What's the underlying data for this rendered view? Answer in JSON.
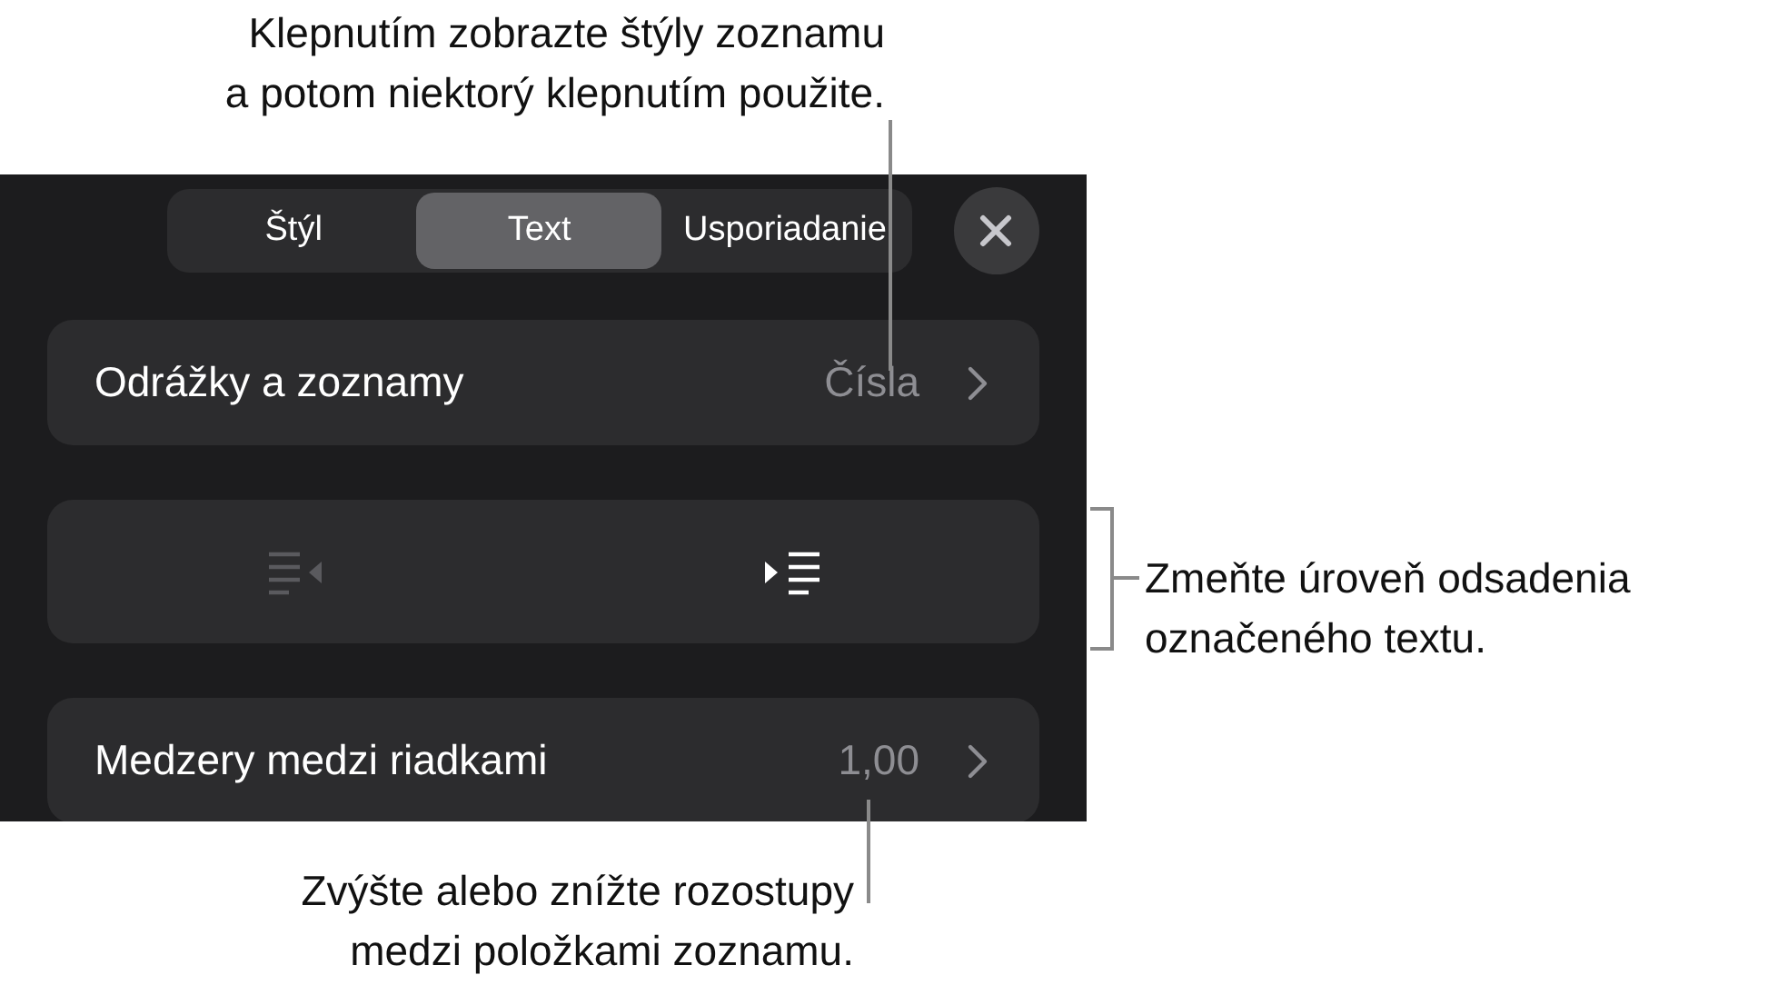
{
  "callouts": {
    "top": "Klepnutím zobrazte štýly zoznamu\na potom niektorý klepnutím použite.",
    "right": "Zmeňte úroveň odsadenia\noznačeného textu.",
    "bottom": "Zvýšte alebo znížte rozostupy\nmedzi položkami zoznamu."
  },
  "tabs": [
    {
      "label": "Štýl",
      "selected": false
    },
    {
      "label": "Text",
      "selected": true
    },
    {
      "label": "Usporiadanie",
      "selected": false
    }
  ],
  "rows": [
    {
      "kind": "disclosure",
      "label": "Odrážky a zoznamy",
      "value": "Čísla"
    },
    {
      "kind": "indent",
      "buttons": [
        {
          "kind": "outdent",
          "disabled": true
        },
        {
          "kind": "indent",
          "disabled": false
        }
      ]
    },
    {
      "kind": "disclosure",
      "label": "Medzery medzi riadkami",
      "value": "1,00"
    }
  ]
}
